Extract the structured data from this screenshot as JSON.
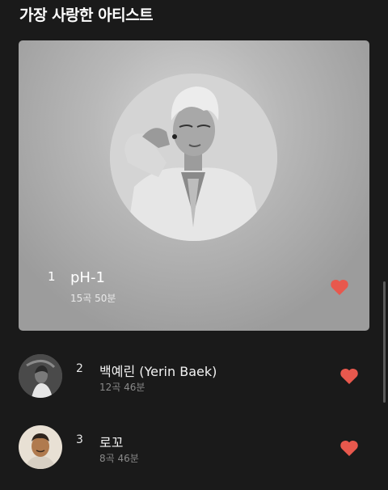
{
  "section": {
    "title": "가장 사랑한 아티스트"
  },
  "featured": {
    "rank": "1",
    "name": "pH-1",
    "meta": "15곡 50분",
    "favorite_icon": "heart-icon"
  },
  "artists": [
    {
      "rank": "2",
      "name": "백예린 (Yerin Baek)",
      "meta": "12곡 46분",
      "favorite_icon": "heart-icon"
    },
    {
      "rank": "3",
      "name": "로꼬",
      "meta": "8곡 46분",
      "favorite_icon": "heart-icon"
    }
  ],
  "colors": {
    "background": "#1a1a1a",
    "heart": "#e8584d",
    "card": "#b3b3b3"
  }
}
